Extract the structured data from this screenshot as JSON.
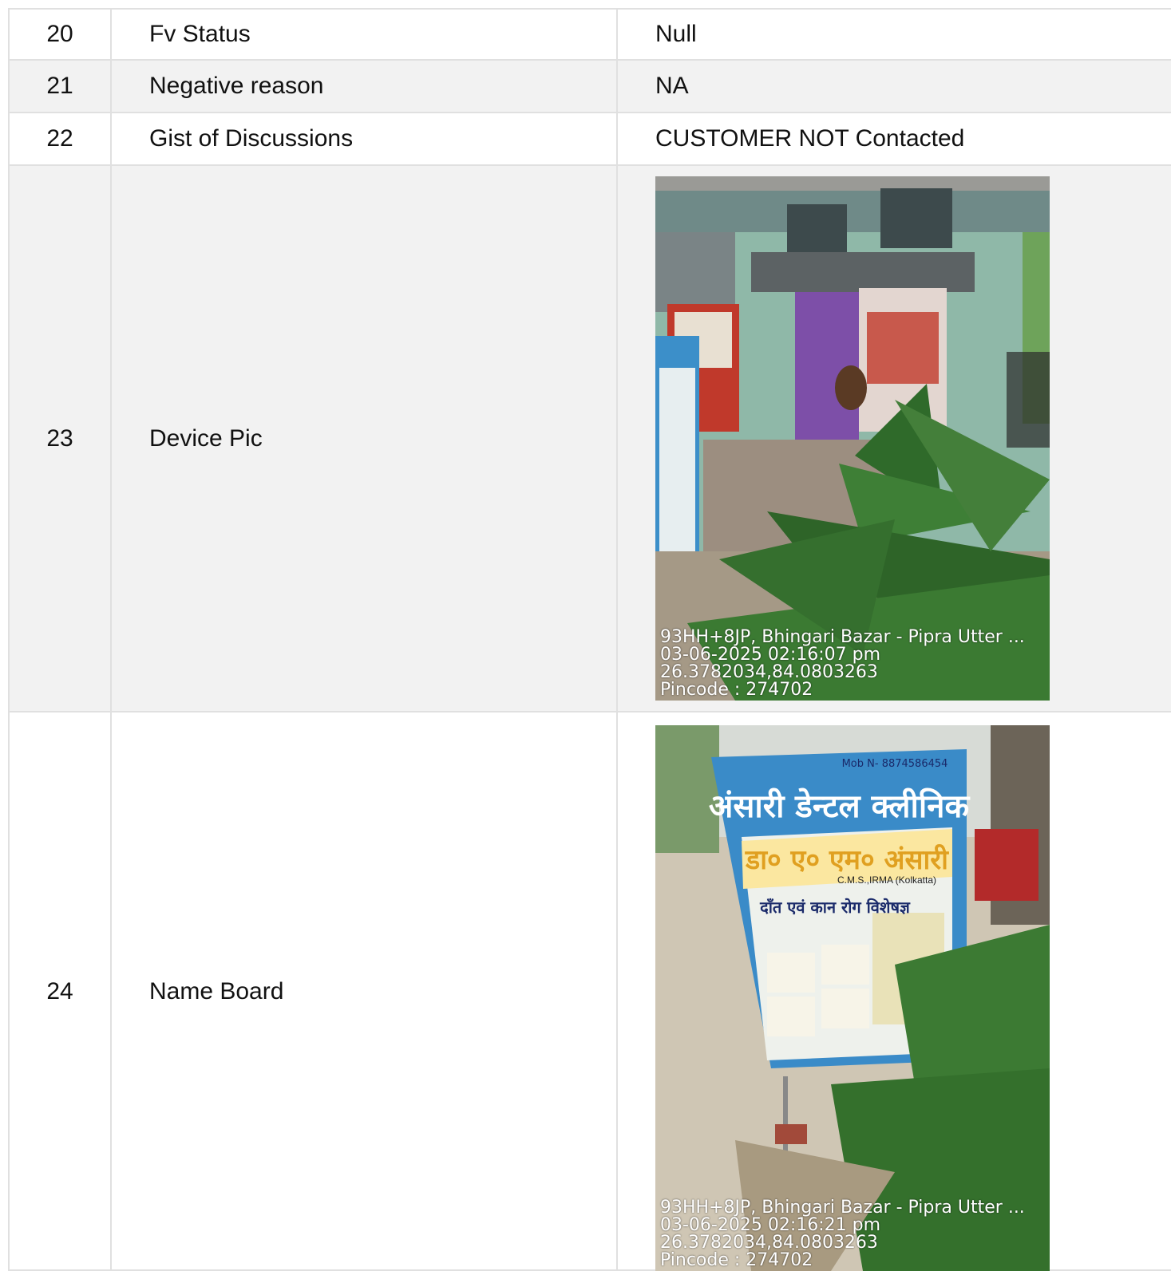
{
  "rows": [
    {
      "no": "20",
      "label": "Fv Status",
      "value": "Null"
    },
    {
      "no": "21",
      "label": "Negative reason",
      "value": "NA"
    },
    {
      "no": "22",
      "label": "Gist of Discussions",
      "value": "CUSTOMER NOT Contacted"
    },
    {
      "no": "23",
      "label": "Device Pic",
      "photo": {
        "description": "storefront with green palm plant",
        "stamp": [
          "93HH+8JP, Bhingari Bazar - Pipra Utter ...",
          "03-06-2025 02:16:07 pm",
          "26.3782034,84.0803263",
          "Pincode : 274702"
        ]
      }
    },
    {
      "no": "24",
      "label": "Name Board",
      "photo": {
        "description": "dental clinic name board sign",
        "board_title": "अंसारी डेन्टल क्लीनिक",
        "board_doctor": "डा० ए० एम० अंसारी",
        "board_qual": "C.M.S.,IRMA (Kolkatta)",
        "board_specialty": "दाँत एवं कान रोग विशेषज्ञ",
        "board_mobile": "Mob N- 8874586454",
        "stamp": [
          "93HH+8JP, Bhingari Bazar - Pipra Utter ...",
          "03-06-2025 02:16:21 pm",
          "26.3782034,84.0803263",
          "Pincode : 274702"
        ]
      }
    }
  ],
  "colors": {
    "border": "#e0e0e0",
    "stripe": "#f2f2f2",
    "text": "#111111"
  }
}
